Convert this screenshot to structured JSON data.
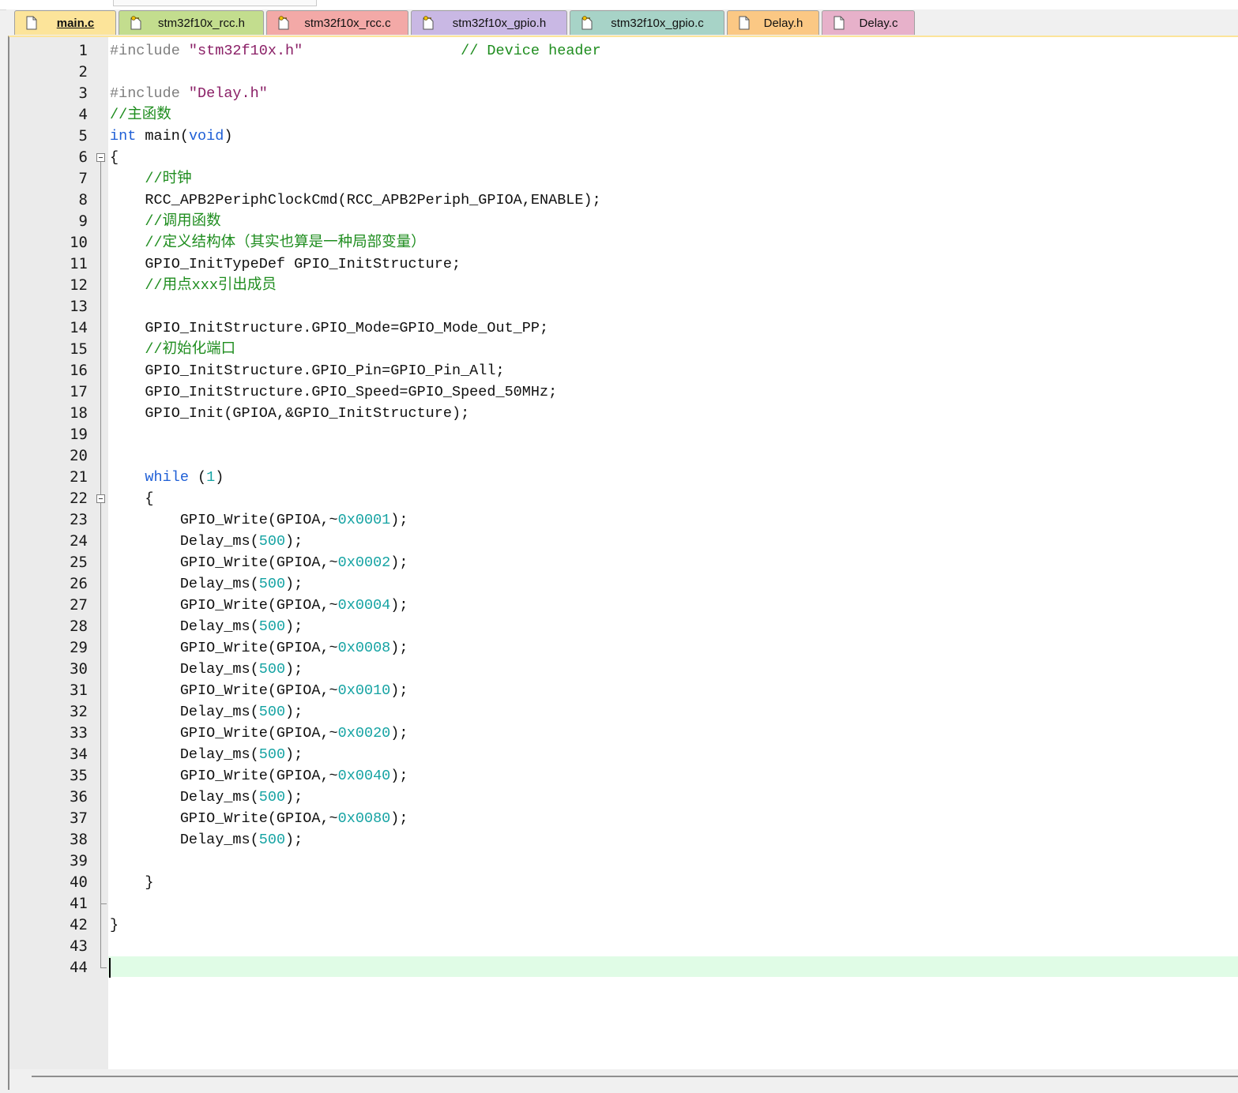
{
  "tabs": [
    {
      "label": "main.c",
      "icon": "file-icon",
      "active": true
    },
    {
      "label": "stm32f10x_rcc.h",
      "icon": "header-file-icon"
    },
    {
      "label": "stm32f10x_rcc.c",
      "icon": "header-file-icon"
    },
    {
      "label": "stm32f10x_gpio.h",
      "icon": "header-file-icon"
    },
    {
      "label": "stm32f10x_gpio.c",
      "icon": "header-file-icon"
    },
    {
      "label": "Delay.h",
      "icon": "file-icon"
    },
    {
      "label": "Delay.c",
      "icon": "file-icon"
    }
  ],
  "editor": {
    "current_line": 44,
    "lines": [
      {
        "n": "1",
        "tokens": [
          [
            "pre",
            "#include "
          ],
          [
            "str",
            "\"stm32f10x.h\""
          ],
          [
            "op",
            "                  "
          ],
          [
            "cmt",
            "// Device header"
          ]
        ]
      },
      {
        "n": "2",
        "tokens": []
      },
      {
        "n": "3",
        "tokens": [
          [
            "pre",
            "#include "
          ],
          [
            "str",
            "\"Delay.h\""
          ]
        ]
      },
      {
        "n": "4",
        "tokens": [
          [
            "cmt",
            "//主函数"
          ]
        ]
      },
      {
        "n": "5",
        "tokens": [
          [
            "kw",
            "int"
          ],
          [
            "op",
            " main("
          ],
          [
            "kw",
            "void"
          ],
          [
            "op",
            ")"
          ]
        ]
      },
      {
        "n": "6",
        "tokens": [
          [
            "op",
            "{"
          ]
        ]
      },
      {
        "n": "7",
        "tokens": [
          [
            "op",
            "    "
          ],
          [
            "cmt",
            "//时钟"
          ]
        ]
      },
      {
        "n": "8",
        "tokens": [
          [
            "op",
            "    RCC_APB2PeriphClockCmd(RCC_APB2Periph_GPIOA,ENABLE);"
          ]
        ]
      },
      {
        "n": "9",
        "tokens": [
          [
            "op",
            "    "
          ],
          [
            "cmt",
            "//调用函数"
          ]
        ]
      },
      {
        "n": "10",
        "tokens": [
          [
            "op",
            "    "
          ],
          [
            "cmt",
            "//定义结构体（其实也算是一种局部变量）"
          ]
        ]
      },
      {
        "n": "11",
        "tokens": [
          [
            "op",
            "    GPIO_InitTypeDef GPIO_InitStructure;"
          ]
        ]
      },
      {
        "n": "12",
        "tokens": [
          [
            "op",
            "    "
          ],
          [
            "cmt",
            "//用点xxx引出成员"
          ]
        ]
      },
      {
        "n": "13",
        "tokens": []
      },
      {
        "n": "14",
        "tokens": [
          [
            "op",
            "    GPIO_InitStructure.GPIO_Mode=GPIO_Mode_Out_PP;"
          ]
        ]
      },
      {
        "n": "15",
        "tokens": [
          [
            "op",
            "    "
          ],
          [
            "cmt",
            "//初始化端口"
          ]
        ]
      },
      {
        "n": "16",
        "tokens": [
          [
            "op",
            "    GPIO_InitStructure.GPIO_Pin=GPIO_Pin_All;"
          ]
        ]
      },
      {
        "n": "17",
        "tokens": [
          [
            "op",
            "    GPIO_InitStructure.GPIO_Speed=GPIO_Speed_50MHz;"
          ]
        ]
      },
      {
        "n": "18",
        "tokens": [
          [
            "op",
            "    GPIO_Init(GPIOA,&GPIO_InitStructure);"
          ]
        ]
      },
      {
        "n": "19",
        "tokens": []
      },
      {
        "n": "20",
        "tokens": []
      },
      {
        "n": "21",
        "tokens": [
          [
            "op",
            "    "
          ],
          [
            "kw",
            "while"
          ],
          [
            "op",
            " ("
          ],
          [
            "num",
            "1"
          ],
          [
            "op",
            ")"
          ]
        ]
      },
      {
        "n": "22",
        "tokens": [
          [
            "op",
            "    {"
          ]
        ]
      },
      {
        "n": "23",
        "tokens": [
          [
            "op",
            "        GPIO_Write(GPIOA,~"
          ],
          [
            "num",
            "0x0001"
          ],
          [
            "op",
            ");"
          ]
        ]
      },
      {
        "n": "24",
        "tokens": [
          [
            "op",
            "        Delay_ms("
          ],
          [
            "num",
            "500"
          ],
          [
            "op",
            ");"
          ]
        ]
      },
      {
        "n": "25",
        "tokens": [
          [
            "op",
            "        GPIO_Write(GPIOA,~"
          ],
          [
            "num",
            "0x0002"
          ],
          [
            "op",
            ");"
          ]
        ]
      },
      {
        "n": "26",
        "tokens": [
          [
            "op",
            "        Delay_ms("
          ],
          [
            "num",
            "500"
          ],
          [
            "op",
            ");"
          ]
        ]
      },
      {
        "n": "27",
        "tokens": [
          [
            "op",
            "        GPIO_Write(GPIOA,~"
          ],
          [
            "num",
            "0x0004"
          ],
          [
            "op",
            ");"
          ]
        ]
      },
      {
        "n": "28",
        "tokens": [
          [
            "op",
            "        Delay_ms("
          ],
          [
            "num",
            "500"
          ],
          [
            "op",
            ");"
          ]
        ]
      },
      {
        "n": "29",
        "tokens": [
          [
            "op",
            "        GPIO_Write(GPIOA,~"
          ],
          [
            "num",
            "0x0008"
          ],
          [
            "op",
            ");"
          ]
        ]
      },
      {
        "n": "30",
        "tokens": [
          [
            "op",
            "        Delay_ms("
          ],
          [
            "num",
            "500"
          ],
          [
            "op",
            ");"
          ]
        ]
      },
      {
        "n": "31",
        "tokens": [
          [
            "op",
            "        GPIO_Write(GPIOA,~"
          ],
          [
            "num",
            "0x0010"
          ],
          [
            "op",
            ");"
          ]
        ]
      },
      {
        "n": "32",
        "tokens": [
          [
            "op",
            "        Delay_ms("
          ],
          [
            "num",
            "500"
          ],
          [
            "op",
            ");"
          ]
        ]
      },
      {
        "n": "33",
        "tokens": [
          [
            "op",
            "        GPIO_Write(GPIOA,~"
          ],
          [
            "num",
            "0x0020"
          ],
          [
            "op",
            ");"
          ]
        ]
      },
      {
        "n": "34",
        "tokens": [
          [
            "op",
            "        Delay_ms("
          ],
          [
            "num",
            "500"
          ],
          [
            "op",
            ");"
          ]
        ]
      },
      {
        "n": "35",
        "tokens": [
          [
            "op",
            "        GPIO_Write(GPIOA,~"
          ],
          [
            "num",
            "0x0040"
          ],
          [
            "op",
            ");"
          ]
        ]
      },
      {
        "n": "36",
        "tokens": [
          [
            "op",
            "        Delay_ms("
          ],
          [
            "num",
            "500"
          ],
          [
            "op",
            ");"
          ]
        ]
      },
      {
        "n": "37",
        "tokens": [
          [
            "op",
            "        GPIO_Write(GPIOA,~"
          ],
          [
            "num",
            "0x0080"
          ],
          [
            "op",
            ");"
          ]
        ]
      },
      {
        "n": "38",
        "tokens": [
          [
            "op",
            "        Delay_ms("
          ],
          [
            "num",
            "500"
          ],
          [
            "op",
            ");"
          ]
        ]
      },
      {
        "n": "39",
        "tokens": []
      },
      {
        "n": "40",
        "tokens": [
          [
            "op",
            "    }"
          ]
        ]
      },
      {
        "n": "41",
        "tokens": []
      },
      {
        "n": "42",
        "tokens": [
          [
            "op",
            "}"
          ]
        ]
      },
      {
        "n": "43",
        "tokens": []
      },
      {
        "n": "44",
        "tokens": []
      }
    ]
  },
  "colors": {
    "preprocessor": "#7f7f7f",
    "string": "#8a1f66",
    "comment": "#1f8d1f",
    "keyword": "#1f5fd6",
    "number": "#15a3a3",
    "current_line_highlight": "#e0fce6"
  }
}
